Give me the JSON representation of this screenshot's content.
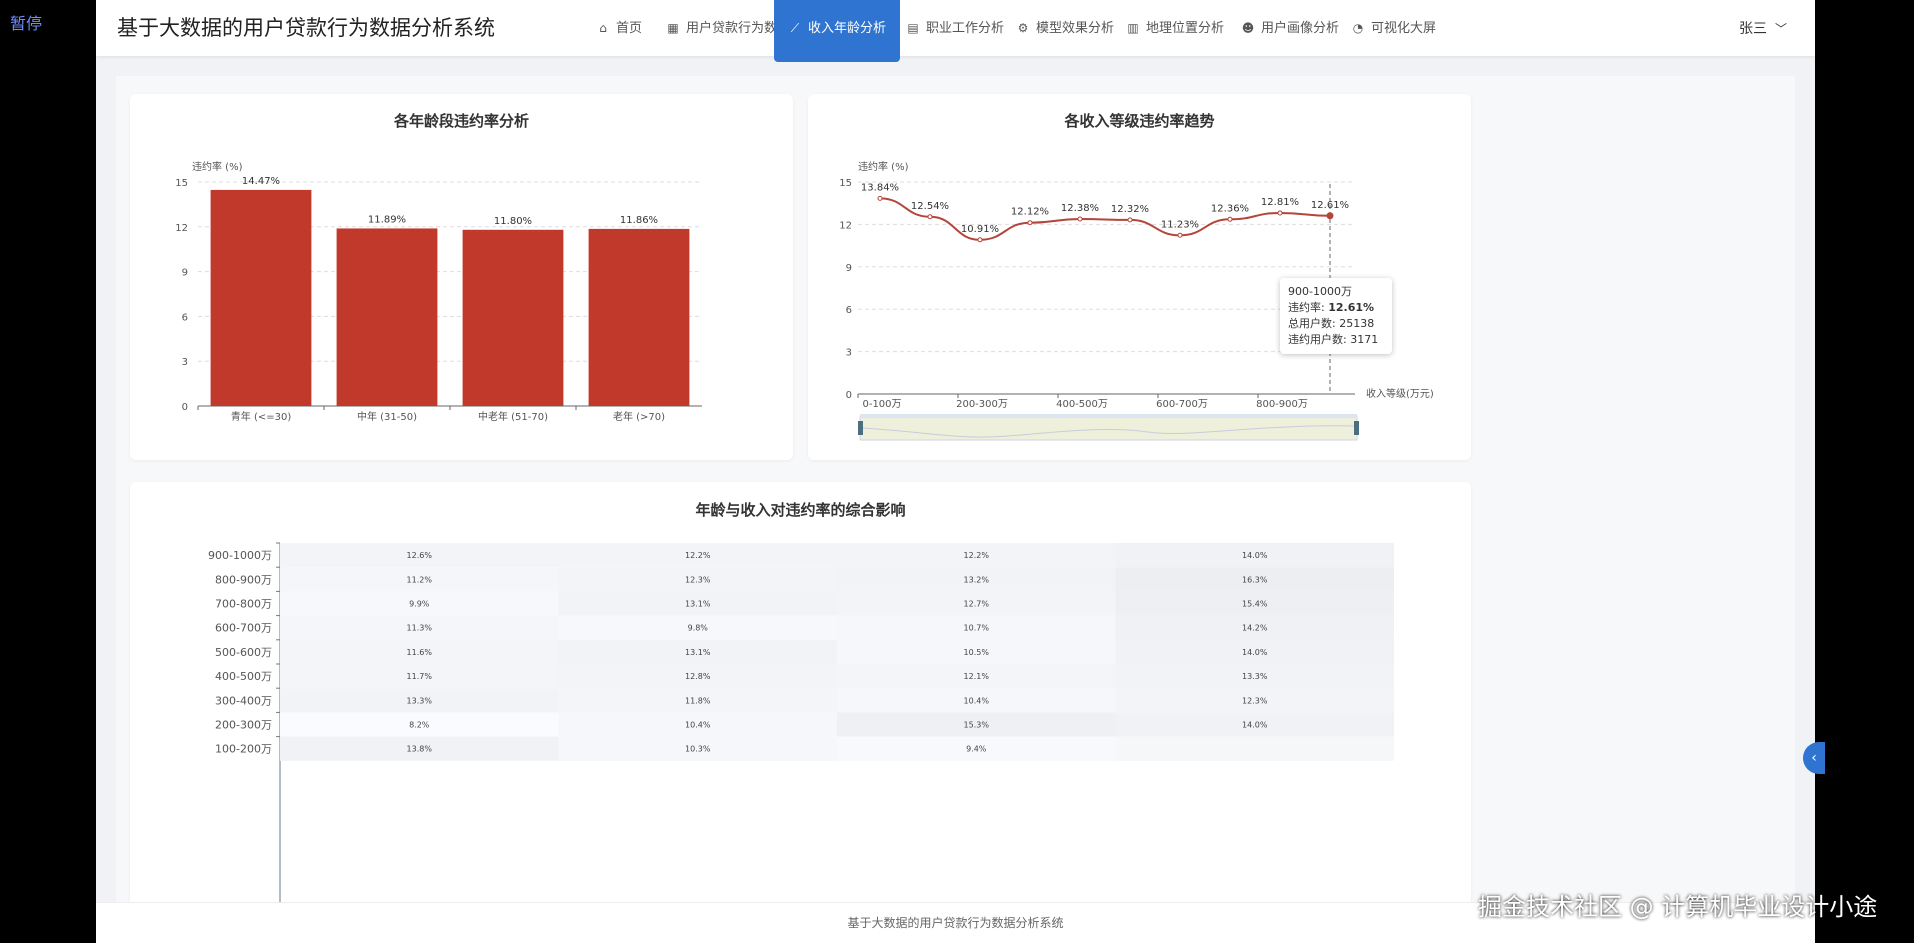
{
  "overlay": {
    "pause_label": "暂停"
  },
  "app": {
    "title": "基于大数据的用户贷款行为数据分析系统",
    "user": "张三",
    "footer": "基于大数据的用户贷款行为数据分析系统",
    "watermark": "掘金技术社区 @ 计算机毕业设计小途"
  },
  "nav": {
    "items": [
      {
        "label": "首页",
        "icon": "home-icon",
        "active": false
      },
      {
        "label": "用户贷款行为数据",
        "icon": "table-icon",
        "active": false
      },
      {
        "label": "收入年龄分析",
        "icon": "line-chart-icon",
        "active": true
      },
      {
        "label": "职业工作分析",
        "icon": "briefcase-icon",
        "active": false
      },
      {
        "label": "模型效果分析",
        "icon": "gears-icon",
        "active": false
      },
      {
        "label": "地理位置分析",
        "icon": "map-icon",
        "active": false
      },
      {
        "label": "用户画像分析",
        "icon": "users-icon",
        "active": false
      },
      {
        "label": "可视化大屏",
        "icon": "pie-chart-icon",
        "active": false
      }
    ]
  },
  "colors": {
    "accent": "#2f74d0",
    "bar": "#c0392b",
    "line": "#b5443a"
  },
  "chart_data": [
    {
      "type": "bar",
      "title": "各年龄段违约率分析",
      "ylabel": "违约率 (%)",
      "categories": [
        "青年 (<=30)",
        "中年 (31-50)",
        "中老年 (51-70)",
        "老年 (>70)"
      ],
      "values": [
        14.47,
        11.89,
        11.8,
        11.86
      ],
      "data_labels": [
        "14.47%",
        "11.89%",
        "11.80%",
        "11.86%"
      ],
      "ylim": [
        0,
        15
      ],
      "yticks": [
        0,
        3,
        6,
        9,
        12,
        15
      ],
      "grid": true
    },
    {
      "type": "line",
      "title": "各收入等级违约率趋势",
      "ylabel": "违约率 (%)",
      "xlabel": "收入等级(万元)",
      "categories": [
        "0-100万",
        "100-200万",
        "200-300万",
        "300-400万",
        "400-500万",
        "500-600万",
        "600-700万",
        "700-800万",
        "800-900万",
        "900-1000万"
      ],
      "shown_tick_labels": [
        "0-100万",
        "200-300万",
        "400-500万",
        "600-700万",
        "800-900万"
      ],
      "values": [
        13.84,
        12.54,
        10.91,
        12.12,
        12.38,
        12.32,
        11.23,
        12.36,
        12.81,
        12.61
      ],
      "data_labels": [
        "13.84%",
        "12.54%",
        "10.91%",
        "12.12%",
        "12.38%",
        "12.32%",
        "11.23%",
        "12.36%",
        "12.81%",
        "12.61%"
      ],
      "ylim": [
        0,
        15
      ],
      "yticks": [
        0,
        3,
        6,
        9,
        12,
        15
      ],
      "grid": true,
      "tooltip": {
        "title": "900-1000万",
        "rate_label": "违约率: ",
        "rate_value": "12.61%",
        "total_label": "总用户数: ",
        "total_value": "25138",
        "default_label": "违约用户数: ",
        "default_value": "3171"
      }
    },
    {
      "type": "heatmap",
      "title": "年龄与收入对违约率的综合影响",
      "y_categories": [
        "900-1000万",
        "800-900万",
        "700-800万",
        "600-700万",
        "500-600万",
        "400-500万",
        "300-400万",
        "200-300万",
        "100-200万"
      ],
      "rows": [
        [
          "12.6%",
          "12.2%",
          "12.2%",
          "14.0%"
        ],
        [
          "11.2%",
          "12.3%",
          "13.2%",
          "16.3%"
        ],
        [
          "9.9%",
          "13.1%",
          "12.7%",
          "15.4%"
        ],
        [
          "11.3%",
          "9.8%",
          "10.7%",
          "14.2%"
        ],
        [
          "11.6%",
          "13.1%",
          "10.5%",
          "14.0%"
        ],
        [
          "11.7%",
          "12.8%",
          "12.1%",
          "13.3%"
        ],
        [
          "13.3%",
          "11.8%",
          "10.4%",
          "12.3%"
        ],
        [
          "8.2%",
          "10.4%",
          "15.3%",
          "14.0%"
        ],
        [
          "13.8%",
          "10.3%",
          "9.4%",
          ""
        ]
      ]
    }
  ]
}
